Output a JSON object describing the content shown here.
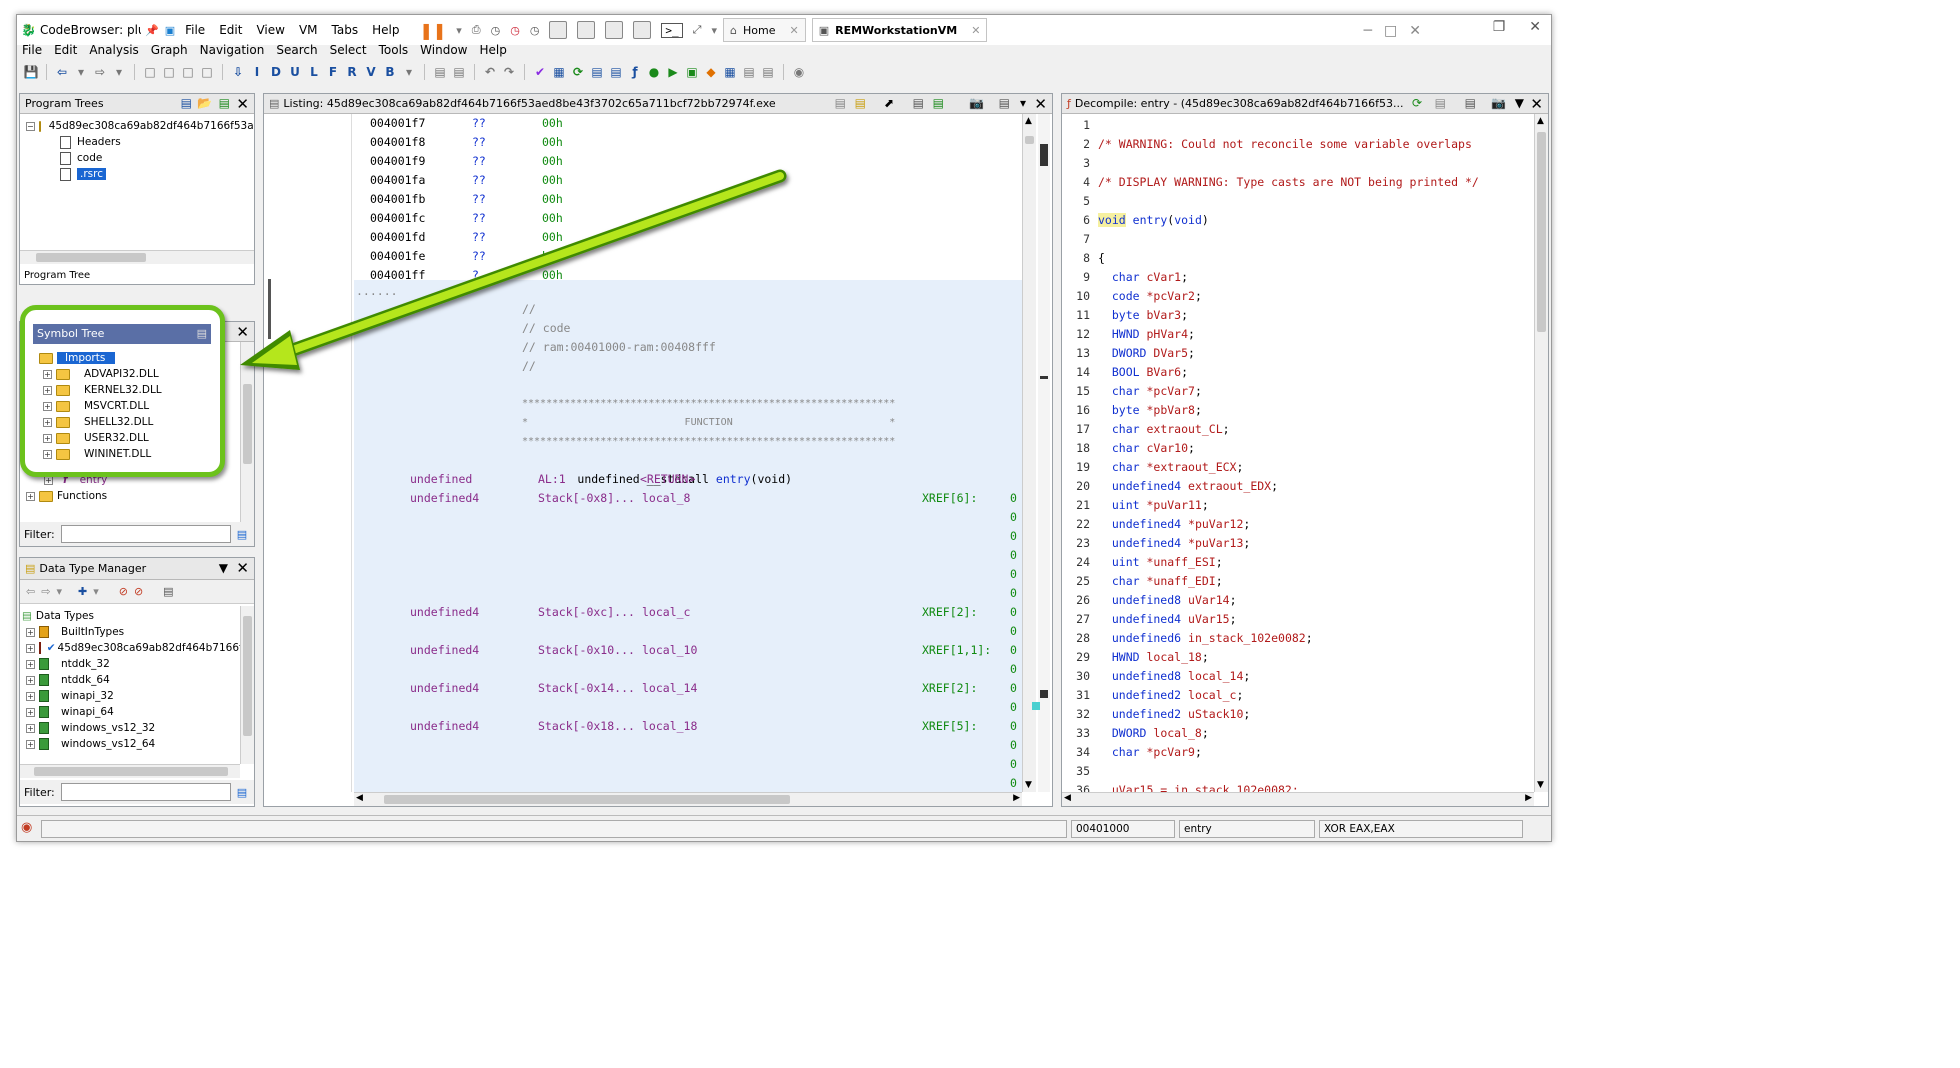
{
  "vm": {
    "app_title": "CodeBrowser: plu",
    "menu": [
      "File",
      "Edit",
      "View",
      "VM",
      "Tabs",
      "Help"
    ],
    "tabs": [
      {
        "label": "Home"
      },
      {
        "label": "REMWorkstationVM"
      }
    ]
  },
  "ghidra_menu": [
    "File",
    "Edit",
    "Analysis",
    "Graph",
    "Navigation",
    "Search",
    "Select",
    "Tools",
    "Window",
    "Help"
  ],
  "toolbar_letters": [
    "I",
    "D",
    "U",
    "L",
    "F",
    "R",
    "V",
    "B"
  ],
  "program_trees": {
    "title": "Program Trees",
    "root": "45d89ec308ca69ab82df464b7166f53aed",
    "items": [
      "Headers",
      "code",
      ".rsrc"
    ],
    "selected": ".rsrc",
    "tab_label": "Program Tree"
  },
  "symbol_tree": {
    "title": "Symbol Tree",
    "imports_label": "Imports",
    "dlls": [
      "ADVAPI32.DLL",
      "KERNEL32.DLL",
      "MSVCRT.DLL",
      "SHELL32.DLL",
      "USER32.DLL",
      "WININET.DLL"
    ],
    "entry_label": "entry",
    "functions_label": "Functions",
    "filter_label": "Filter:"
  },
  "data_type_manager": {
    "title": "Data Type Manager",
    "root": "Data Types",
    "items": [
      "BuiltInTypes",
      "45d89ec308ca69ab82df464b7166f53a",
      "ntddk_32",
      "ntddk_64",
      "winapi_32",
      "winapi_64",
      "windows_vs12_32",
      "windows_vs12_64"
    ],
    "filter_label": "Filter:"
  },
  "listing": {
    "title": "Listing:  45d89ec308ca69ab82df464b7166f53aed8be43f3702c65a711bcf72bb72974f.exe",
    "addr_rows": [
      {
        "addr": "004001f7",
        "q": "??",
        "val": "00h"
      },
      {
        "addr": "004001f8",
        "q": "??",
        "val": "00h"
      },
      {
        "addr": "004001f9",
        "q": "??",
        "val": "00h"
      },
      {
        "addr": "004001fa",
        "q": "??",
        "val": "00h"
      },
      {
        "addr": "004001fb",
        "q": "??",
        "val": "00h"
      },
      {
        "addr": "004001fc",
        "q": "??",
        "val": "00h"
      },
      {
        "addr": "004001fd",
        "q": "??",
        "val": "00h"
      },
      {
        "addr": "004001fe",
        "q": "??",
        "val": "h"
      },
      {
        "addr": "004001ff",
        "q": "?",
        "val": "00h"
      }
    ],
    "dots": "......",
    "comments": [
      "//",
      "// code",
      "// ram:00401000-ram:00408fff",
      "//"
    ],
    "stars": "**************************************************************",
    "function_banner": "*                          FUNCTION                          *",
    "signature": {
      "ret": "undefined",
      "conv": "__stdcall",
      "name": "entry",
      "args": "(void)"
    },
    "return_row": {
      "type": "undefined",
      "reg": "AL:1",
      "label": "<RETURN>"
    },
    "locals": [
      {
        "type": "undefined4",
        "stack": "Stack[-0x8]...",
        "name": "local_8",
        "xref": "XREF[6]:"
      },
      {
        "type": "undefined4",
        "stack": "Stack[-0xc]...",
        "name": "local_c",
        "xref": "XREF[2]:"
      },
      {
        "type": "undefined4",
        "stack": "Stack[-0x10...",
        "name": "local_10",
        "xref": "XREF[1,1]:"
      },
      {
        "type": "undefined4",
        "stack": "Stack[-0x14...",
        "name": "local_14",
        "xref": "XREF[2]:"
      },
      {
        "type": "undefined4",
        "stack": "Stack[-0x18...",
        "name": "local_18",
        "xref": "XREF[5]:"
      }
    ],
    "xref_col": [
      "0",
      "0",
      "0",
      "0",
      "0",
      "0",
      "0",
      "0",
      "0",
      "0",
      "0",
      "0",
      "0",
      "0",
      "0",
      "0"
    ]
  },
  "decompile": {
    "title": "Decompile: entry - (45d89ec308ca69ab82df464b7166f53...",
    "lines": [
      {
        "n": "1",
        "parts": []
      },
      {
        "n": "2",
        "parts": [
          {
            "c": "cmt",
            "t": "/* WARNING: Could not reconcile some variable overlaps"
          }
        ]
      },
      {
        "n": "3",
        "parts": []
      },
      {
        "n": "4",
        "parts": [
          {
            "c": "cmt",
            "t": "/* DISPLAY WARNING: Type casts are NOT being printed */"
          }
        ]
      },
      {
        "n": "5",
        "parts": []
      },
      {
        "n": "6",
        "parts": [
          {
            "c": "type hl",
            "t": "void"
          },
          {
            "c": "",
            "t": " "
          },
          {
            "c": "fn",
            "t": "entry"
          },
          {
            "c": "",
            "t": "("
          },
          {
            "c": "type",
            "t": "void"
          },
          {
            "c": "",
            "t": ")"
          }
        ]
      },
      {
        "n": "7",
        "parts": []
      },
      {
        "n": "8",
        "parts": [
          {
            "c": "",
            "t": "{"
          }
        ]
      },
      {
        "n": "9",
        "parts": [
          {
            "c": "type",
            "t": "  char"
          },
          {
            "c": "var",
            "t": " cVar1"
          },
          {
            "c": "",
            "t": ";"
          }
        ]
      },
      {
        "n": "10",
        "parts": [
          {
            "c": "type",
            "t": "  code"
          },
          {
            "c": "var",
            "t": " *pcVar2"
          },
          {
            "c": "",
            "t": ";"
          }
        ]
      },
      {
        "n": "11",
        "parts": [
          {
            "c": "type",
            "t": "  byte"
          },
          {
            "c": "var",
            "t": " bVar3"
          },
          {
            "c": "",
            "t": ";"
          }
        ]
      },
      {
        "n": "12",
        "parts": [
          {
            "c": "type",
            "t": "  HWND"
          },
          {
            "c": "var",
            "t": " pHVar4"
          },
          {
            "c": "",
            "t": ";"
          }
        ]
      },
      {
        "n": "13",
        "parts": [
          {
            "c": "type",
            "t": "  DWORD"
          },
          {
            "c": "var",
            "t": " DVar5"
          },
          {
            "c": "",
            "t": ";"
          }
        ]
      },
      {
        "n": "14",
        "parts": [
          {
            "c": "type",
            "t": "  BOOL"
          },
          {
            "c": "var",
            "t": " BVar6"
          },
          {
            "c": "",
            "t": ";"
          }
        ]
      },
      {
        "n": "15",
        "parts": [
          {
            "c": "type",
            "t": "  char"
          },
          {
            "c": "var",
            "t": " *pcVar7"
          },
          {
            "c": "",
            "t": ";"
          }
        ]
      },
      {
        "n": "16",
        "parts": [
          {
            "c": "type",
            "t": "  byte"
          },
          {
            "c": "var",
            "t": " *pbVar8"
          },
          {
            "c": "",
            "t": ";"
          }
        ]
      },
      {
        "n": "17",
        "parts": [
          {
            "c": "type",
            "t": "  char"
          },
          {
            "c": "var",
            "t": " extraout_CL"
          },
          {
            "c": "",
            "t": ";"
          }
        ]
      },
      {
        "n": "18",
        "parts": [
          {
            "c": "type",
            "t": "  char"
          },
          {
            "c": "var",
            "t": " cVar10"
          },
          {
            "c": "",
            "t": ";"
          }
        ]
      },
      {
        "n": "19",
        "parts": [
          {
            "c": "type",
            "t": "  char"
          },
          {
            "c": "var",
            "t": " *extraout_ECX"
          },
          {
            "c": "",
            "t": ";"
          }
        ]
      },
      {
        "n": "20",
        "parts": [
          {
            "c": "type",
            "t": "  undefined4"
          },
          {
            "c": "var",
            "t": " extraout_EDX"
          },
          {
            "c": "",
            "t": ";"
          }
        ]
      },
      {
        "n": "21",
        "parts": [
          {
            "c": "type",
            "t": "  uint"
          },
          {
            "c": "var",
            "t": " *puVar11"
          },
          {
            "c": "",
            "t": ";"
          }
        ]
      },
      {
        "n": "22",
        "parts": [
          {
            "c": "type",
            "t": "  undefined4"
          },
          {
            "c": "var",
            "t": " *puVar12"
          },
          {
            "c": "",
            "t": ";"
          }
        ]
      },
      {
        "n": "23",
        "parts": [
          {
            "c": "type",
            "t": "  undefined4"
          },
          {
            "c": "var",
            "t": " *puVar13"
          },
          {
            "c": "",
            "t": ";"
          }
        ]
      },
      {
        "n": "24",
        "parts": [
          {
            "c": "type",
            "t": "  uint"
          },
          {
            "c": "var",
            "t": " *unaff_ESI"
          },
          {
            "c": "",
            "t": ";"
          }
        ]
      },
      {
        "n": "25",
        "parts": [
          {
            "c": "type",
            "t": "  char"
          },
          {
            "c": "var",
            "t": " *unaff_EDI"
          },
          {
            "c": "",
            "t": ";"
          }
        ]
      },
      {
        "n": "26",
        "parts": [
          {
            "c": "type",
            "t": "  undefined8"
          },
          {
            "c": "var",
            "t": " uVar14"
          },
          {
            "c": "",
            "t": ";"
          }
        ]
      },
      {
        "n": "27",
        "parts": [
          {
            "c": "type",
            "t": "  undefined4"
          },
          {
            "c": "var",
            "t": " uVar15"
          },
          {
            "c": "",
            "t": ";"
          }
        ]
      },
      {
        "n": "28",
        "parts": [
          {
            "c": "type",
            "t": "  undefined6"
          },
          {
            "c": "var",
            "t": " in_stack_102e0082"
          },
          {
            "c": "",
            "t": ";"
          }
        ]
      },
      {
        "n": "29",
        "parts": [
          {
            "c": "type",
            "t": "  HWND"
          },
          {
            "c": "var",
            "t": " local_18"
          },
          {
            "c": "",
            "t": ";"
          }
        ]
      },
      {
        "n": "30",
        "parts": [
          {
            "c": "type",
            "t": "  undefined8"
          },
          {
            "c": "var",
            "t": " local_14"
          },
          {
            "c": "",
            "t": ";"
          }
        ]
      },
      {
        "n": "31",
        "parts": [
          {
            "c": "type",
            "t": "  undefined2"
          },
          {
            "c": "var",
            "t": " local_c"
          },
          {
            "c": "",
            "t": ";"
          }
        ]
      },
      {
        "n": "32",
        "parts": [
          {
            "c": "type",
            "t": "  undefined2"
          },
          {
            "c": "var",
            "t": " uStack10"
          },
          {
            "c": "",
            "t": ";"
          }
        ]
      },
      {
        "n": "33",
        "parts": [
          {
            "c": "type",
            "t": "  DWORD"
          },
          {
            "c": "var",
            "t": " local_8"
          },
          {
            "c": "",
            "t": ";"
          }
        ]
      },
      {
        "n": "34",
        "parts": [
          {
            "c": "type",
            "t": "  char"
          },
          {
            "c": "var",
            "t": " *pcVar9"
          },
          {
            "c": "",
            "t": ";"
          }
        ]
      },
      {
        "n": "35",
        "parts": []
      },
      {
        "n": "36",
        "parts": [
          {
            "c": "var",
            "t": "  uVar15 = in_stack_102e0082;"
          }
        ]
      }
    ]
  },
  "status": {
    "address": "00401000",
    "function": "entry",
    "instruction": "XOR EAX,EAX"
  },
  "colors": {
    "highlight_green": "#6cc21c",
    "arrow_green": "#3f8a00",
    "listing_bg": "#e6effa",
    "symbol_header": "#5a6fa6"
  }
}
